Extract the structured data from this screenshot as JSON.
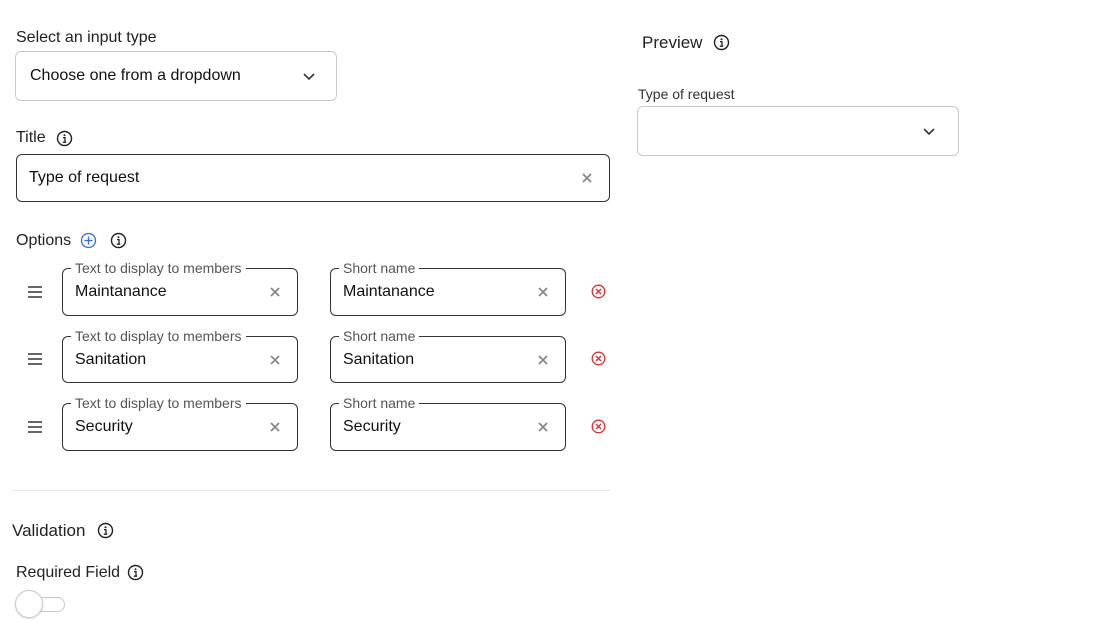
{
  "input_type": {
    "label": "Select an input type",
    "selected": "Choose one from a dropdown"
  },
  "title_field": {
    "label": "Title",
    "value": "Type of request"
  },
  "options": {
    "label": "Options",
    "display_legend": "Text to display to members",
    "short_legend": "Short name",
    "items": [
      {
        "display": "Maintanance",
        "short": "Maintanance"
      },
      {
        "display": "Sanitation",
        "short": "Sanitation"
      },
      {
        "display": "Security",
        "short": "Security"
      }
    ]
  },
  "validation": {
    "heading": "Validation",
    "required_label": "Required Field",
    "required_on": false
  },
  "preview": {
    "heading": "Preview",
    "field_label": "Type of request",
    "selected": ""
  },
  "colors": {
    "accent": "#2f6fd6",
    "danger": "#d32f2f",
    "border": "#c9c9c9"
  }
}
